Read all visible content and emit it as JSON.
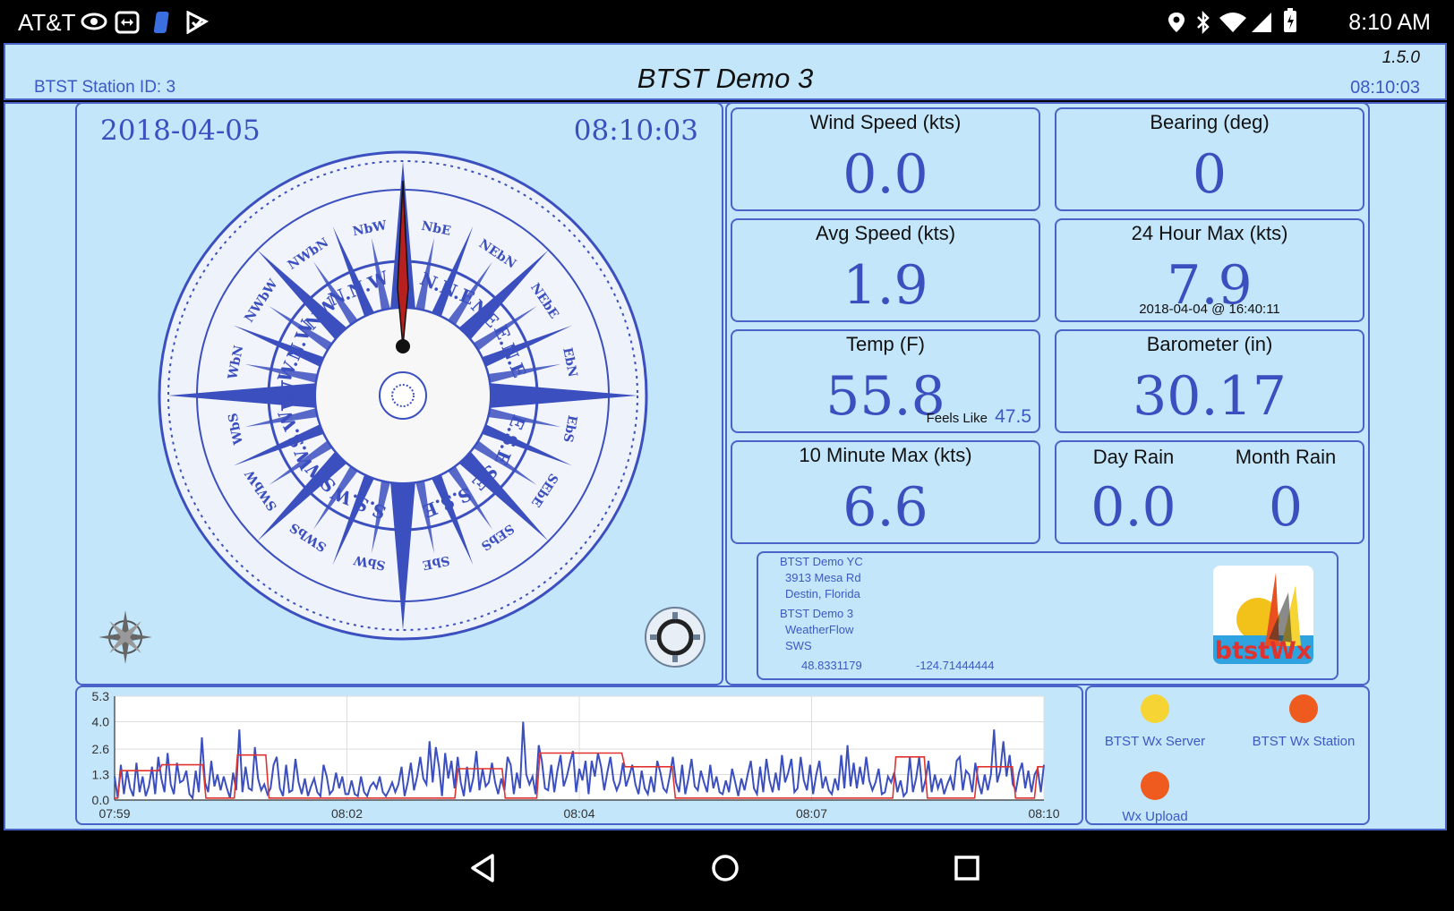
{
  "status_bar": {
    "carrier": "AT&T",
    "time": "8:10 AM"
  },
  "header": {
    "title": "BTST Demo 3",
    "station_id": "BTST Station ID: 3",
    "version": "1.5.0",
    "time": "08:10:03"
  },
  "compass": {
    "date": "2018-04-05",
    "time": "08:10:03",
    "bearing_deg": 0
  },
  "tiles": {
    "wind_speed": {
      "label": "Wind Speed (kts)",
      "value": "0.0"
    },
    "bearing": {
      "label": "Bearing (deg)",
      "value": "0"
    },
    "avg_speed": {
      "label": "Avg Speed (kts)",
      "value": "1.9"
    },
    "max24": {
      "label": "24 Hour Max (kts)",
      "value": "7.9",
      "sub": "2018-04-04 @ 16:40:11"
    },
    "temp": {
      "label": "Temp (F)",
      "value": "55.8",
      "feels_label": "Feels Like",
      "feels_value": "47.5"
    },
    "barometer": {
      "label": "Barometer (in)",
      "value": "30.17"
    },
    "max10": {
      "label": "10 Minute Max (kts)",
      "value": "6.6"
    },
    "day_rain": {
      "label": "Day Rain",
      "value": "0.0"
    },
    "month_rain": {
      "label": "Month Rain",
      "value": "0"
    }
  },
  "info": {
    "club": "BTST Demo YC",
    "address": "3913 Mesa Rd",
    "city": "Destin, Florida",
    "station": "BTST Demo 3",
    "provider": "WeatherFlow",
    "code": "SWS",
    "lat": "48.8331179",
    "lon": "-124.71444444",
    "logo_text": "btstWx"
  },
  "status_indicators": {
    "server": {
      "label": "BTST Wx Server",
      "color": "#f5d433"
    },
    "station": {
      "label": "BTST Wx Station",
      "color": "#ef5a1e"
    },
    "upload": {
      "label": "Wx Upload",
      "color": "#ef5a1e"
    }
  },
  "colors": {
    "accent": "#3b4fbf",
    "panel": "#c4e6fb",
    "border": "#4a63c6"
  },
  "chart_data": {
    "type": "line",
    "yticks": [
      "5.3",
      "4.0",
      "2.6",
      "1.3",
      "0.0"
    ],
    "xticks": [
      "07:59",
      "08:02",
      "08:04",
      "08:07",
      "08:10"
    ],
    "ylim": [
      0,
      5.3
    ],
    "series": [
      {
        "color": "#3b4fbf",
        "values": [
          1.2,
          0.1,
          1.8,
          0.3,
          1.5,
          0.6,
          0.2,
          1.9,
          0.4,
          1.2,
          0.2,
          0.7,
          1.7,
          0.3,
          2.2,
          1.1,
          0.4,
          2.4,
          0.8,
          0.3,
          1.9,
          0.9,
          1.0,
          1.5,
          0.3,
          0.1,
          1.5,
          0.4,
          3.2,
          0.9,
          0.4,
          2.0,
          0.7,
          1.3,
          0.5,
          1.2,
          0.6,
          0.1,
          1.4,
          0.5,
          3.6,
          0.4,
          1.7,
          0.6,
          0.5,
          2.7,
          1.1,
          0.5,
          0.8,
          0.3,
          0.6,
          1.8,
          2.2,
          0.6,
          0.2,
          1.8,
          0.4,
          0.5,
          2.1,
          0.9,
          0.3,
          1.1,
          0.2,
          0.7,
          1.1,
          0.4,
          0.2,
          1.8,
          1.2,
          0.3,
          0.5,
          1.4,
          0.6,
          1.2,
          0.3,
          0.3,
          1.0,
          0.3,
          0.2,
          1.2,
          0.4,
          0.2,
          0.7,
          0.9,
          0.6,
          1.2,
          0.4,
          0.2,
          0.5,
          0.9,
          0.4,
          0.8,
          1.7,
          0.2,
          0.9,
          1.9,
          0.5,
          1.2,
          2.2,
          1.1,
          0.8,
          3.0,
          0.9,
          2.7,
          1.7,
          0.2,
          2.4,
          1.1,
          2.0,
          0.6,
          2.2,
          0.9,
          0.2,
          1.7,
          0.4,
          1.1,
          2.5,
          0.5,
          1.6,
          0.7,
          0.9,
          1.9,
          0.9,
          0.3,
          1.1,
          0.5,
          2.2,
          1.8,
          0.3,
          1.4,
          0.6,
          4.0,
          1.3,
          0.8,
          1.2,
          0.3,
          2.8,
          2.0,
          0.6,
          0.5,
          1.8,
          0.4,
          1.5,
          2.3,
          0.7,
          1.2,
          1.9,
          2.5,
          0.4,
          1.6,
          1.0,
          2.0,
          0.3,
          2.0,
          1.2,
          2.4,
          1.7,
          0.5,
          1.4,
          2.2,
          1.0,
          0.5,
          0.9,
          1.9,
          0.7,
          1.2,
          1.8,
          0.8,
          0.3,
          1.5,
          0.6,
          0.3,
          1.2,
          0.4,
          2.0,
          1.4,
          0.6,
          0.4,
          1.2,
          2.2,
          0.9,
          0.4,
          1.8,
          0.3,
          1.1,
          2.1,
          0.7,
          0.5,
          1.5,
          0.9,
          0.4,
          1.8,
          0.6,
          1.2,
          0.4,
          0.3,
          1.0,
          0.4,
          1.6,
          0.9,
          0.2,
          1.1,
          0.5,
          1.3,
          2.0,
          0.6,
          0.3,
          1.7,
          0.4,
          2.1,
          1.0,
          0.4,
          1.4,
          0.5,
          2.3,
          0.9,
          1.4,
          2.1,
          0.4,
          0.6,
          2.2,
          1.0,
          0.5,
          1.8,
          0.3,
          1.3,
          2.0,
          0.6,
          1.2,
          0.5,
          0.3,
          1.1,
          0.5,
          2.3,
          0.6,
          2.8,
          0.7,
          1.9,
          0.6,
          1.7,
          0.8,
          2.2,
          1.0,
          0.5,
          0.9,
          1.6,
          0.3,
          0.4,
          1.2,
          0.9,
          1.4,
          0.4,
          1.0,
          0.2,
          0.4,
          2.2,
          0.4,
          1.1,
          2.2,
          0.4,
          1.0,
          2.0,
          0.4,
          1.3,
          0.6,
          1.1,
          0.3,
          0.8,
          1.2,
          0.5,
          2.0,
          2.2,
          0.5,
          1.5,
          1.3,
          0.4,
          1.9,
          0.9,
          0.3,
          1.3,
          0.5,
          1.3,
          3.6,
          0.9,
          1.5,
          3.0,
          1.2,
          2.3,
          0.8,
          0.5,
          1.4,
          1.9,
          0.6,
          1.5,
          0.4,
          1.3,
          1.6,
          0.4,
          1.8
        ]
      },
      {
        "color": "#e0322e",
        "values": [
          0.1,
          0.1,
          1.5,
          1.5,
          1.5,
          1.5,
          1.5,
          1.5,
          1.5,
          1.5,
          1.5,
          1.5,
          1.5,
          1.5,
          1.5,
          1.8,
          1.8,
          1.8,
          1.8,
          1.8,
          1.8,
          1.8,
          1.8,
          1.8,
          1.8,
          1.8,
          1.8,
          1.8,
          1.8,
          0.1,
          0.1,
          0.1,
          0.1,
          0.1,
          0.1,
          0.1,
          0.1,
          0.1,
          0.1,
          2.3,
          2.3,
          2.3,
          2.3,
          2.3,
          2.3,
          2.3,
          2.3,
          2.3,
          2.3,
          0.1,
          0.1,
          0.1,
          0.1,
          0.1,
          0.1,
          0.1,
          0.1,
          0.1,
          0.1,
          0.1,
          0.1,
          0.1,
          0.1,
          0.1,
          0.1,
          0.1,
          0.1,
          0.1,
          0.1,
          0.1,
          0.1,
          0.1,
          0.1,
          0.1,
          0.1,
          0.1,
          0.1,
          0.1,
          0.1,
          0.1,
          0.1,
          0.1,
          0.1,
          0.1,
          0.1,
          0.1,
          0.1,
          0.1,
          0.1,
          0.1,
          0.1,
          0.1,
          0.1,
          0.1,
          0.1,
          0.1,
          0.1,
          0.1,
          0.1,
          0.1,
          0.1,
          0.1,
          0.1,
          0.1,
          0.1,
          0.1,
          0.1,
          0.1,
          0.1,
          1.6,
          1.6,
          1.6,
          1.6,
          1.6,
          1.6,
          1.6,
          1.6,
          1.6,
          1.6,
          1.6,
          1.6,
          1.6,
          1.6,
          1.6,
          0.1,
          0.1,
          0.1,
          0.1,
          0.1,
          0.1,
          0.1,
          0.1,
          0.1,
          0.1,
          0.1,
          2.4,
          2.4,
          2.4,
          2.4,
          2.4,
          2.4,
          2.4,
          2.4,
          2.4,
          2.4,
          2.4,
          2.4,
          2.4,
          2.4,
          2.4,
          2.4,
          2.4,
          2.4,
          2.4,
          2.4,
          2.4,
          2.4,
          2.4,
          2.4,
          2.4,
          2.4,
          2.4,
          1.7,
          1.7,
          1.7,
          1.7,
          1.7,
          1.7,
          1.7,
          1.7,
          1.7,
          1.7,
          1.7,
          1.7,
          1.7,
          1.7,
          1.7,
          1.7,
          0.1,
          0.1,
          0.1,
          0.1,
          0.1,
          0.1,
          0.1,
          0.1,
          0.1,
          0.1,
          0.1,
          0.1,
          0.1,
          0.1,
          0.1,
          0.1,
          0.1,
          0.1,
          0.1,
          0.1,
          0.1,
          0.1,
          0.1,
          0.1,
          0.1,
          0.1,
          0.1,
          0.1,
          0.1,
          0.1,
          0.1,
          0.1,
          0.1,
          0.1,
          0.1,
          0.1,
          0.1,
          0.1,
          0.1,
          0.1,
          0.1,
          0.1,
          0.1,
          0.1,
          0.1,
          0.1,
          0.1,
          0.1,
          0.1,
          0.1,
          0.1,
          0.1,
          0.1,
          0.1,
          0.1,
          0.1,
          0.1,
          0.1,
          0.1,
          0.1,
          0.1,
          0.1,
          0.1,
          0.1,
          0.1,
          0.1,
          0.1,
          0.1,
          0.1,
          0.1,
          2.2,
          2.2,
          2.2,
          2.2,
          2.2,
          2.2,
          2.2,
          2.2,
          2.2,
          2.2,
          0.1,
          0.1,
          0.1,
          0.1,
          0.1,
          0.1,
          0.1,
          0.1,
          0.1,
          0.1,
          0.1,
          0.1,
          0.1,
          0.1,
          0.1,
          0.1,
          1.7,
          1.7,
          1.7,
          1.7,
          1.7,
          1.7,
          1.7,
          1.7,
          1.7,
          1.7,
          1.7,
          1.7,
          0.1,
          0.1,
          0.1,
          0.1,
          0.1,
          0.1,
          0.1,
          1.7,
          1.7,
          1.7
        ]
      }
    ]
  }
}
